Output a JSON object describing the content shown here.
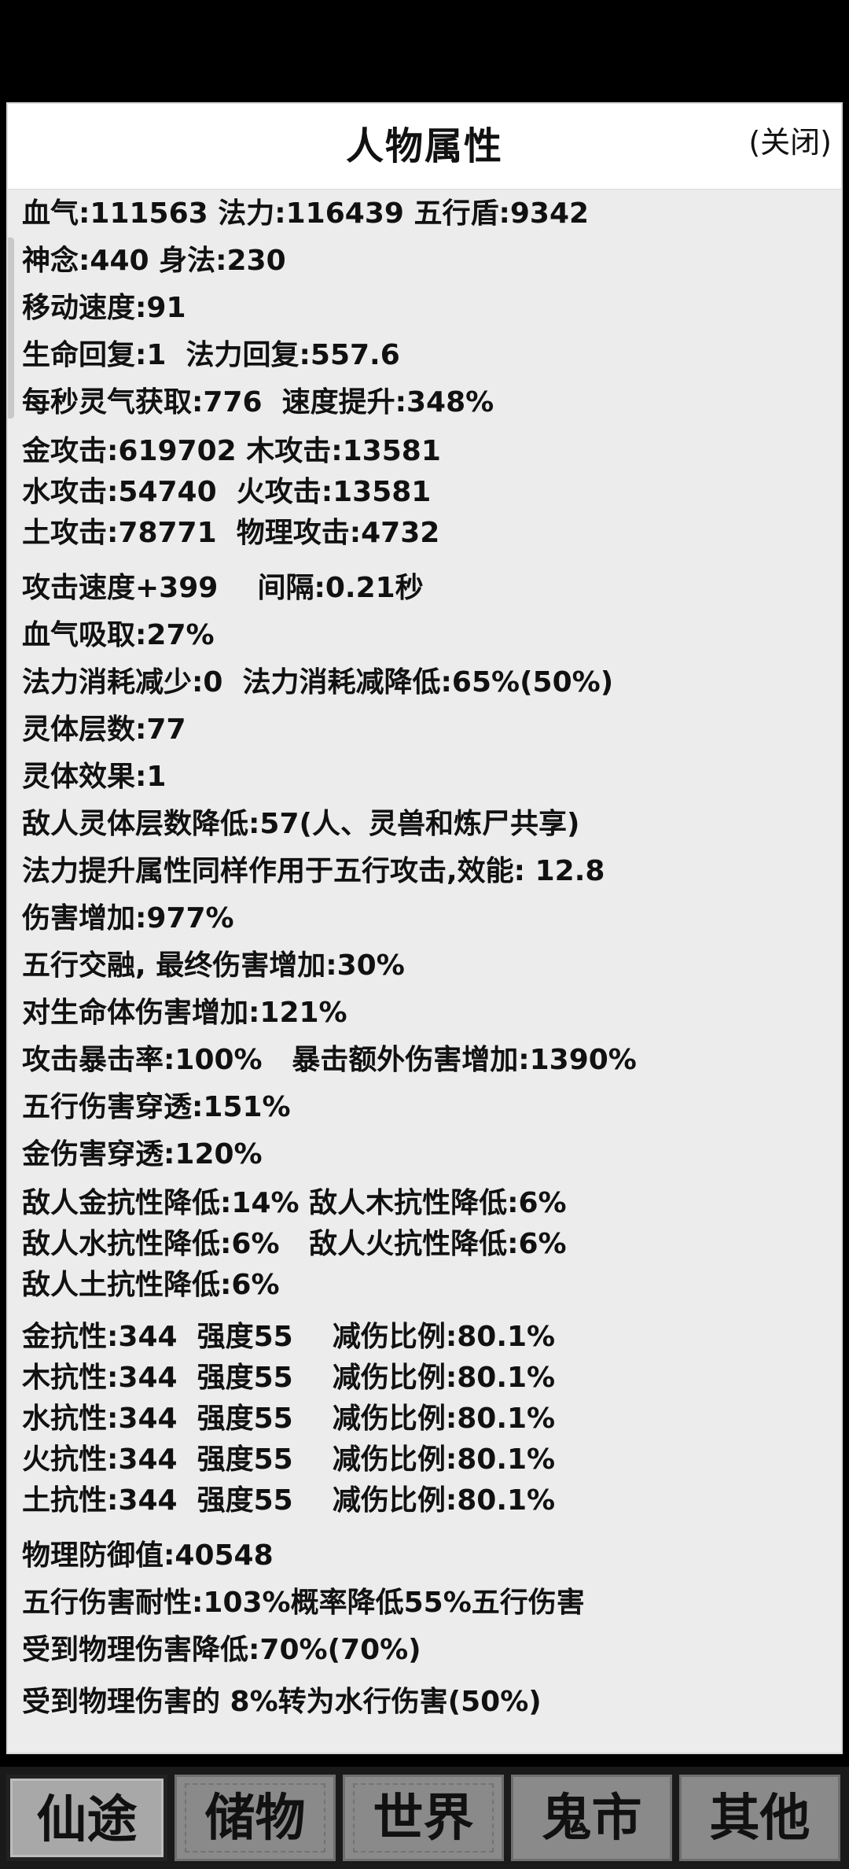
{
  "header": {
    "title": "人物属性",
    "close_label": "(关闭)"
  },
  "attributes": [
    "血气:111563 法力:116439 五行盾:9342",
    "神念:440 身法:230",
    "移动速度:91",
    "生命回复:1  法力回复:557.6",
    "每秒灵气获取:776  速度提升:348%",
    "金攻击:619702 木攻击:13581",
    "水攻击:54740  火攻击:13581",
    "土攻击:78771  物理攻击:4732",
    "攻击速度+399    间隔:0.21秒",
    "血气吸取:27%",
    "法力消耗减少:0  法力消耗减降低:65%(50%)",
    "灵体层数:77",
    "灵体效果:1",
    "敌人灵体层数降低:57(人、灵兽和炼尸共享)",
    "法力提升属性同样作用于五行攻击,效能: 12.8",
    "伤害增加:977%",
    "五行交融, 最终伤害增加:30%",
    "对生命体伤害增加:121%",
    "攻击暴击率:100%   暴击额外伤害增加:1390%",
    "五行伤害穿透:151%",
    "金伤害穿透:120%",
    "敌人金抗性降低:14% 敌人木抗性降低:6%",
    "敌人水抗性降低:6%   敌人火抗性降低:6%",
    "敌人土抗性降低:6%",
    "金抗性:344  强度55    减伤比例:80.1%",
    "木抗性:344  强度55    减伤比例:80.1%",
    "水抗性:344  强度55    减伤比例:80.1%",
    "火抗性:344  强度55    减伤比例:80.1%",
    "土抗性:344  强度55    减伤比例:80.1%",
    "物理防御值:40548",
    "五行伤害耐性:103%概率降低55%五行伤害",
    "受到物理伤害降低:70%(70%)",
    "受到物理伤害的 8%转为水行伤害(50%)"
  ],
  "tabs": [
    {
      "label": "仙途",
      "active": true
    },
    {
      "label": "储物"
    },
    {
      "label": "世界"
    },
    {
      "label": "鬼市"
    },
    {
      "label": "其他"
    }
  ],
  "colors": {
    "panel": "#ececec",
    "header": "#ffffff",
    "text": "#111111",
    "background": "#000000"
  }
}
